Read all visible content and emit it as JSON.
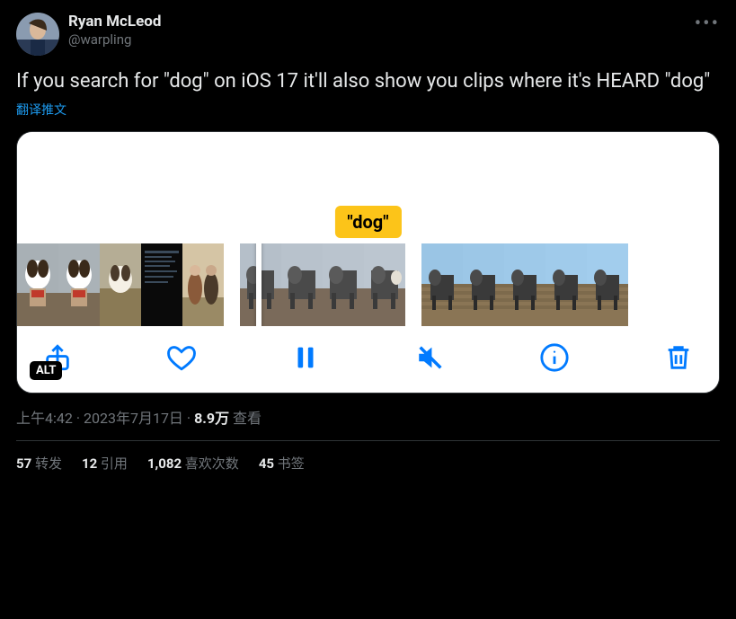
{
  "author": {
    "display_name": "Ryan McLeod",
    "handle": "@warpling"
  },
  "tweet_text": "If you search for \"dog\" on iOS 17 it'll also show you clips where it's HEARD \"dog\"",
  "translate_label": "翻译推文",
  "media": {
    "badge_text": "\"dog\"",
    "alt_label": "ALT"
  },
  "meta": {
    "time": "上午4:42",
    "date": "2023年7月17日",
    "views_count": "8.9万",
    "views_label": "查看"
  },
  "stats": {
    "retweets_count": "57",
    "retweets_label": "转发",
    "quotes_count": "12",
    "quotes_label": "引用",
    "likes_count": "1,082",
    "likes_label": "喜欢次数",
    "bookmarks_count": "45",
    "bookmarks_label": "书签"
  }
}
